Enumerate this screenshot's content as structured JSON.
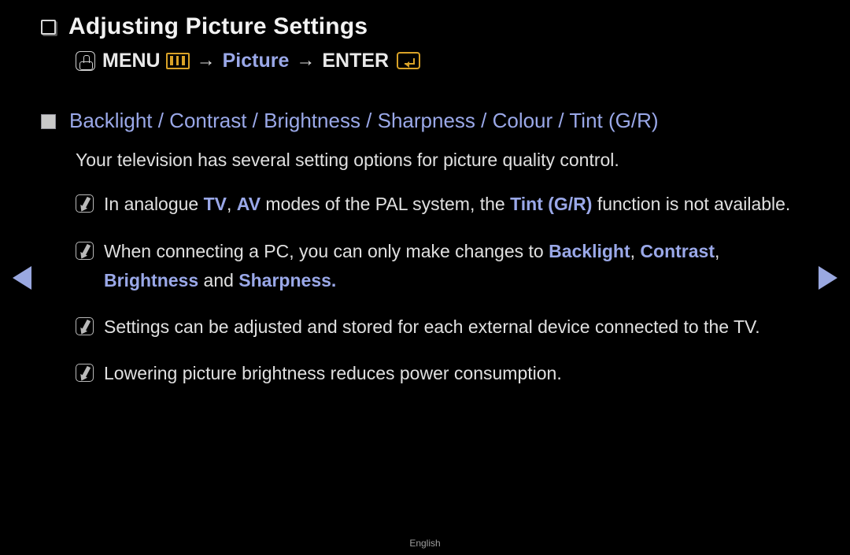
{
  "page": {
    "background_color": "#000000",
    "accent_blue": "#9aa8e8",
    "accent_gold": "#d9a227",
    "text_color": "#e0e0e0"
  },
  "title": {
    "bullet_icon": "square-outline-icon",
    "text": "Adjusting Picture Settings"
  },
  "menu_path": {
    "hand_icon": "hand-press-icon",
    "menu_label": "MENU",
    "menu_bars_icon": "menu-bars-icon",
    "arrow1": "→",
    "picture_label": "Picture",
    "arrow2": "→",
    "enter_label": "ENTER",
    "enter_icon": "enter-key-icon"
  },
  "section": {
    "bullet_icon": "square-filled-icon",
    "heading": "Backlight / Contrast / Brightness / Sharpness / Colour / Tint (G/R)",
    "description": "Your television has several setting options for picture quality control."
  },
  "notes": [
    {
      "icon": "note-pencil-icon",
      "html": "In analogue <b>TV</b>, <b>AV</b> modes of the PAL system, the <b>Tint (G/R)</b> function is not available."
    },
    {
      "icon": "note-pencil-icon",
      "html": "When connecting a PC, you can only make changes to <b>Backlight</b>, <b>Contrast</b>, <b>Brightness</b> and <b>Sharpness.</b>"
    },
    {
      "icon": "note-pencil-icon",
      "html": "Settings can be adjusted and stored for each external device connected to the TV."
    },
    {
      "icon": "note-pencil-icon",
      "html": "Lowering picture brightness reduces power consumption."
    }
  ],
  "navigation": {
    "prev_icon": "triangle-left-icon",
    "next_icon": "triangle-right-icon"
  },
  "footer": {
    "language": "English"
  }
}
